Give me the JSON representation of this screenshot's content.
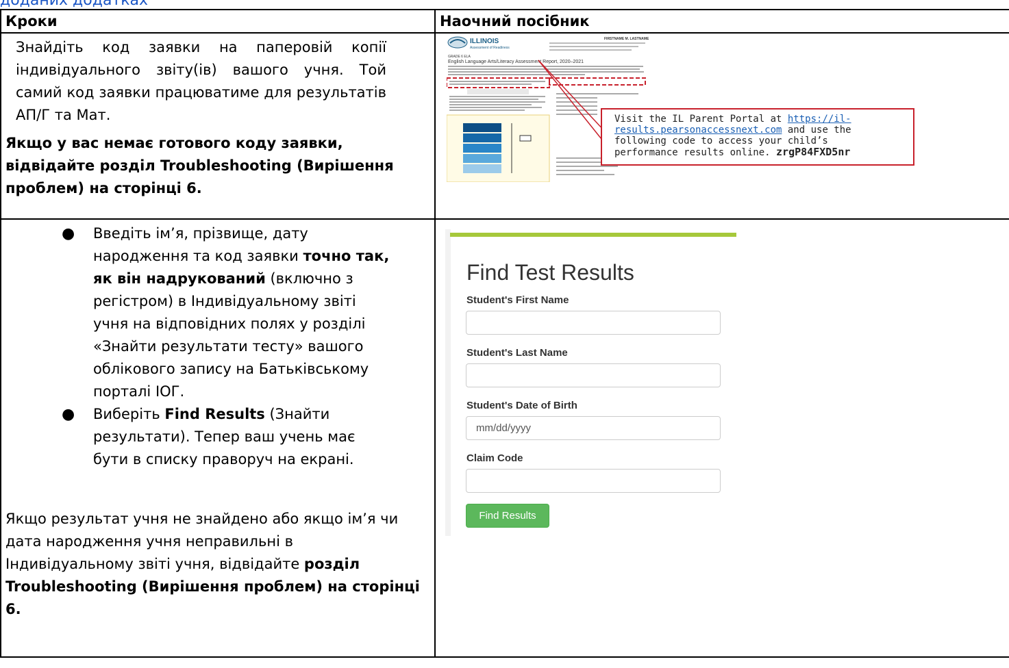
{
  "top_link": "доданих додатках",
  "table": {
    "header_steps": "Кроки",
    "header_visual": "Наочний посібник"
  },
  "row1": {
    "text": "Знайдіть код заявки на паперовій копії індивідуального звіту(ів) вашого учня. Той самий код заявки працюватиме для результатів АП/Г та Мат.",
    "bold_note": "Якщо у вас немає готового коду заявки, відвідайте розділ Troubleshooting (Вирішення проблем) на сторінці 6."
  },
  "row2": {
    "bullet1_a": "Введіть ім’я, прізвище, дату народження та код заявки ",
    "bullet1_b": "точно так, як він надрукований",
    "bullet1_c": " (включно з регістром) в Індивідуальному звіті учня на відповідних полях у розділі «Знайти результати тесту» вашого облікового запису на Батьківському порталі ІОГ.",
    "bullet2_a": "Виберіть ",
    "bullet2_b": "Find Results",
    "bullet2_c": " (Знайти результати). Тепер ваш учень має бути в списку праворуч на екрані.",
    "note_a": "Якщо результат учня не знайдено або якщо ім’я чи дата народження учня неправильні в Індивідуальному звіті учня, відвідайте ",
    "note_b": "розділ Troubleshooting (Вирішення проблем) на сторінці 6."
  },
  "report": {
    "logo": "ILLINOIS",
    "logo_sub": "Assessment of Readiness",
    "student_name": "FIRSTNAME M. LASTNAME",
    "grade_ela": "GRADE 6 ELA",
    "report_title": "English Language Arts/Literacy Assessment Report, 2020–2021",
    "callout_line1": "Visit the IL Parent Portal at ",
    "callout_link1": "https://il-",
    "callout_link2": "results.pearsonaccessnext.com",
    "callout_line2": " and use the",
    "callout_line3": "following code to access your child’s",
    "callout_line4": "performance results online.  ",
    "callout_code": "zrgP84FXD5nr",
    "accent_color": "#c8202b"
  },
  "form": {
    "title": "Find Test Results",
    "first_name_label": "Student's First Name",
    "last_name_label": "Student's Last Name",
    "dob_label": "Student's Date of Birth",
    "dob_placeholder": "mm/dd/yyyy",
    "claim_label": "Claim Code",
    "button_label": "Find Results",
    "bar_color": "#a6c83b",
    "button_color": "#5cb85c"
  }
}
